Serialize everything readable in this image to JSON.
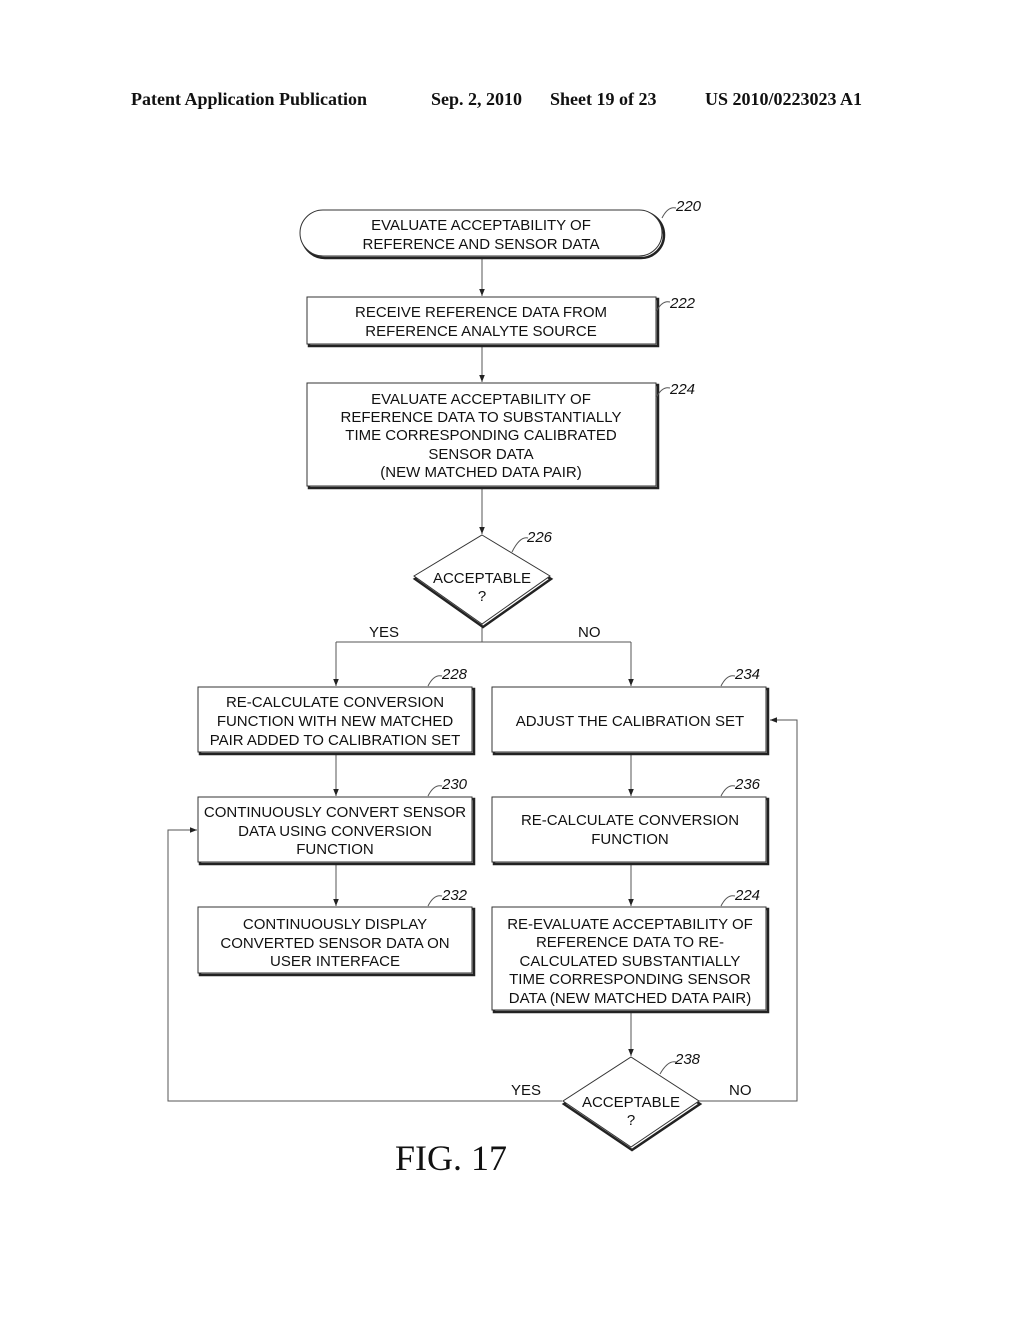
{
  "header": {
    "publication": "Patent Application Publication",
    "date": "Sep. 2, 2010",
    "sheet": "Sheet 19 of 23",
    "number": "US 2010/0223023 A1"
  },
  "figure_label": "FIG. 17",
  "nodes": {
    "n220": {
      "ref": "220",
      "lines": [
        "EVALUATE ACCEPTABILITY OF",
        "REFERENCE AND SENSOR DATA"
      ]
    },
    "n222": {
      "ref": "222",
      "lines": [
        "RECEIVE REFERENCE DATA FROM",
        "REFERENCE ANALYTE SOURCE"
      ]
    },
    "n224": {
      "ref": "224",
      "lines": [
        "EVALUATE ACCEPTABILITY OF",
        "REFERENCE DATA TO SUBSTANTIALLY",
        "TIME CORRESPONDING CALIBRATED",
        "SENSOR DATA",
        "(NEW MATCHED DATA PAIR)"
      ]
    },
    "n226": {
      "ref": "226",
      "lines": [
        "ACCEPTABLE",
        "?"
      ]
    },
    "n228": {
      "ref": "228",
      "lines": [
        "RE-CALCULATE CONVERSION",
        "FUNCTION WITH NEW MATCHED",
        "PAIR ADDED TO CALIBRATION SET"
      ]
    },
    "n230": {
      "ref": "230",
      "lines": [
        "CONTINUOUSLY CONVERT SENSOR",
        "DATA USING CONVERSION",
        "FUNCTION"
      ]
    },
    "n232": {
      "ref": "232",
      "lines": [
        "CONTINUOUSLY DISPLAY",
        "CONVERTED SENSOR DATA ON",
        "USER INTERFACE"
      ]
    },
    "n234": {
      "ref": "234",
      "lines": [
        "ADJUST THE CALIBRATION SET"
      ]
    },
    "n236": {
      "ref": "236",
      "lines": [
        "RE-CALCULATE CONVERSION",
        "FUNCTION"
      ]
    },
    "n224b": {
      "ref": "224",
      "lines": [
        "RE-EVALUATE ACCEPTABILITY OF",
        "REFERENCE DATA TO RE-",
        "CALCULATED SUBSTANTIALLY",
        "TIME CORRESPONDING SENSOR",
        "DATA (NEW MATCHED DATA PAIR)"
      ]
    },
    "n238": {
      "ref": "238",
      "lines": [
        "ACCEPTABLE",
        "?"
      ]
    }
  },
  "branch_labels": {
    "d226_yes": "YES",
    "d226_no": "NO",
    "d238_yes": "YES",
    "d238_no": "NO"
  }
}
